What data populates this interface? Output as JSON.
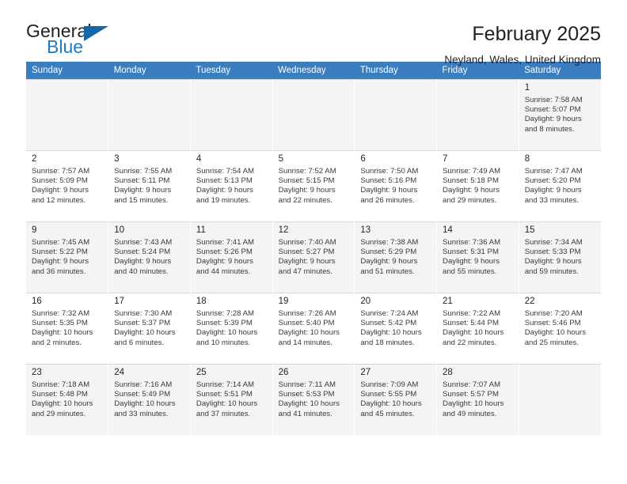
{
  "brand": {
    "name_top": "General",
    "name_bottom": "Blue",
    "triangle_icon": "blue-triangle-icon",
    "accent_color": "#1368ab"
  },
  "header": {
    "title": "February 2025",
    "subtitle": "Neyland, Wales, United Kingdom"
  },
  "table": {
    "header_bg": "#3a7dc0",
    "columns": [
      "Sunday",
      "Monday",
      "Tuesday",
      "Wednesday",
      "Thursday",
      "Friday",
      "Saturday"
    ]
  },
  "labels": {
    "sunrise": "Sunrise:",
    "sunset": "Sunset:",
    "daylight": "Daylight:"
  },
  "weeks": [
    [
      null,
      null,
      null,
      null,
      null,
      null,
      {
        "day": "1",
        "sunrise": "Sunrise: 7:58 AM",
        "sunset": "Sunset: 5:07 PM",
        "daylight": "Daylight: 9 hours and 8 minutes."
      }
    ],
    [
      {
        "day": "2",
        "sunrise": "Sunrise: 7:57 AM",
        "sunset": "Sunset: 5:09 PM",
        "daylight": "Daylight: 9 hours and 12 minutes."
      },
      {
        "day": "3",
        "sunrise": "Sunrise: 7:55 AM",
        "sunset": "Sunset: 5:11 PM",
        "daylight": "Daylight: 9 hours and 15 minutes."
      },
      {
        "day": "4",
        "sunrise": "Sunrise: 7:54 AM",
        "sunset": "Sunset: 5:13 PM",
        "daylight": "Daylight: 9 hours and 19 minutes."
      },
      {
        "day": "5",
        "sunrise": "Sunrise: 7:52 AM",
        "sunset": "Sunset: 5:15 PM",
        "daylight": "Daylight: 9 hours and 22 minutes."
      },
      {
        "day": "6",
        "sunrise": "Sunrise: 7:50 AM",
        "sunset": "Sunset: 5:16 PM",
        "daylight": "Daylight: 9 hours and 26 minutes."
      },
      {
        "day": "7",
        "sunrise": "Sunrise: 7:49 AM",
        "sunset": "Sunset: 5:18 PM",
        "daylight": "Daylight: 9 hours and 29 minutes."
      },
      {
        "day": "8",
        "sunrise": "Sunrise: 7:47 AM",
        "sunset": "Sunset: 5:20 PM",
        "daylight": "Daylight: 9 hours and 33 minutes."
      }
    ],
    [
      {
        "day": "9",
        "sunrise": "Sunrise: 7:45 AM",
        "sunset": "Sunset: 5:22 PM",
        "daylight": "Daylight: 9 hours and 36 minutes."
      },
      {
        "day": "10",
        "sunrise": "Sunrise: 7:43 AM",
        "sunset": "Sunset: 5:24 PM",
        "daylight": "Daylight: 9 hours and 40 minutes."
      },
      {
        "day": "11",
        "sunrise": "Sunrise: 7:41 AM",
        "sunset": "Sunset: 5:26 PM",
        "daylight": "Daylight: 9 hours and 44 minutes."
      },
      {
        "day": "12",
        "sunrise": "Sunrise: 7:40 AM",
        "sunset": "Sunset: 5:27 PM",
        "daylight": "Daylight: 9 hours and 47 minutes."
      },
      {
        "day": "13",
        "sunrise": "Sunrise: 7:38 AM",
        "sunset": "Sunset: 5:29 PM",
        "daylight": "Daylight: 9 hours and 51 minutes."
      },
      {
        "day": "14",
        "sunrise": "Sunrise: 7:36 AM",
        "sunset": "Sunset: 5:31 PM",
        "daylight": "Daylight: 9 hours and 55 minutes."
      },
      {
        "day": "15",
        "sunrise": "Sunrise: 7:34 AM",
        "sunset": "Sunset: 5:33 PM",
        "daylight": "Daylight: 9 hours and 59 minutes."
      }
    ],
    [
      {
        "day": "16",
        "sunrise": "Sunrise: 7:32 AM",
        "sunset": "Sunset: 5:35 PM",
        "daylight": "Daylight: 10 hours and 2 minutes."
      },
      {
        "day": "17",
        "sunrise": "Sunrise: 7:30 AM",
        "sunset": "Sunset: 5:37 PM",
        "daylight": "Daylight: 10 hours and 6 minutes."
      },
      {
        "day": "18",
        "sunrise": "Sunrise: 7:28 AM",
        "sunset": "Sunset: 5:39 PM",
        "daylight": "Daylight: 10 hours and 10 minutes."
      },
      {
        "day": "19",
        "sunrise": "Sunrise: 7:26 AM",
        "sunset": "Sunset: 5:40 PM",
        "daylight": "Daylight: 10 hours and 14 minutes."
      },
      {
        "day": "20",
        "sunrise": "Sunrise: 7:24 AM",
        "sunset": "Sunset: 5:42 PM",
        "daylight": "Daylight: 10 hours and 18 minutes."
      },
      {
        "day": "21",
        "sunrise": "Sunrise: 7:22 AM",
        "sunset": "Sunset: 5:44 PM",
        "daylight": "Daylight: 10 hours and 22 minutes."
      },
      {
        "day": "22",
        "sunrise": "Sunrise: 7:20 AM",
        "sunset": "Sunset: 5:46 PM",
        "daylight": "Daylight: 10 hours and 25 minutes."
      }
    ],
    [
      {
        "day": "23",
        "sunrise": "Sunrise: 7:18 AM",
        "sunset": "Sunset: 5:48 PM",
        "daylight": "Daylight: 10 hours and 29 minutes."
      },
      {
        "day": "24",
        "sunrise": "Sunrise: 7:16 AM",
        "sunset": "Sunset: 5:49 PM",
        "daylight": "Daylight: 10 hours and 33 minutes."
      },
      {
        "day": "25",
        "sunrise": "Sunrise: 7:14 AM",
        "sunset": "Sunset: 5:51 PM",
        "daylight": "Daylight: 10 hours and 37 minutes."
      },
      {
        "day": "26",
        "sunrise": "Sunrise: 7:11 AM",
        "sunset": "Sunset: 5:53 PM",
        "daylight": "Daylight: 10 hours and 41 minutes."
      },
      {
        "day": "27",
        "sunrise": "Sunrise: 7:09 AM",
        "sunset": "Sunset: 5:55 PM",
        "daylight": "Daylight: 10 hours and 45 minutes."
      },
      {
        "day": "28",
        "sunrise": "Sunrise: 7:07 AM",
        "sunset": "Sunset: 5:57 PM",
        "daylight": "Daylight: 10 hours and 49 minutes."
      },
      null
    ]
  ]
}
